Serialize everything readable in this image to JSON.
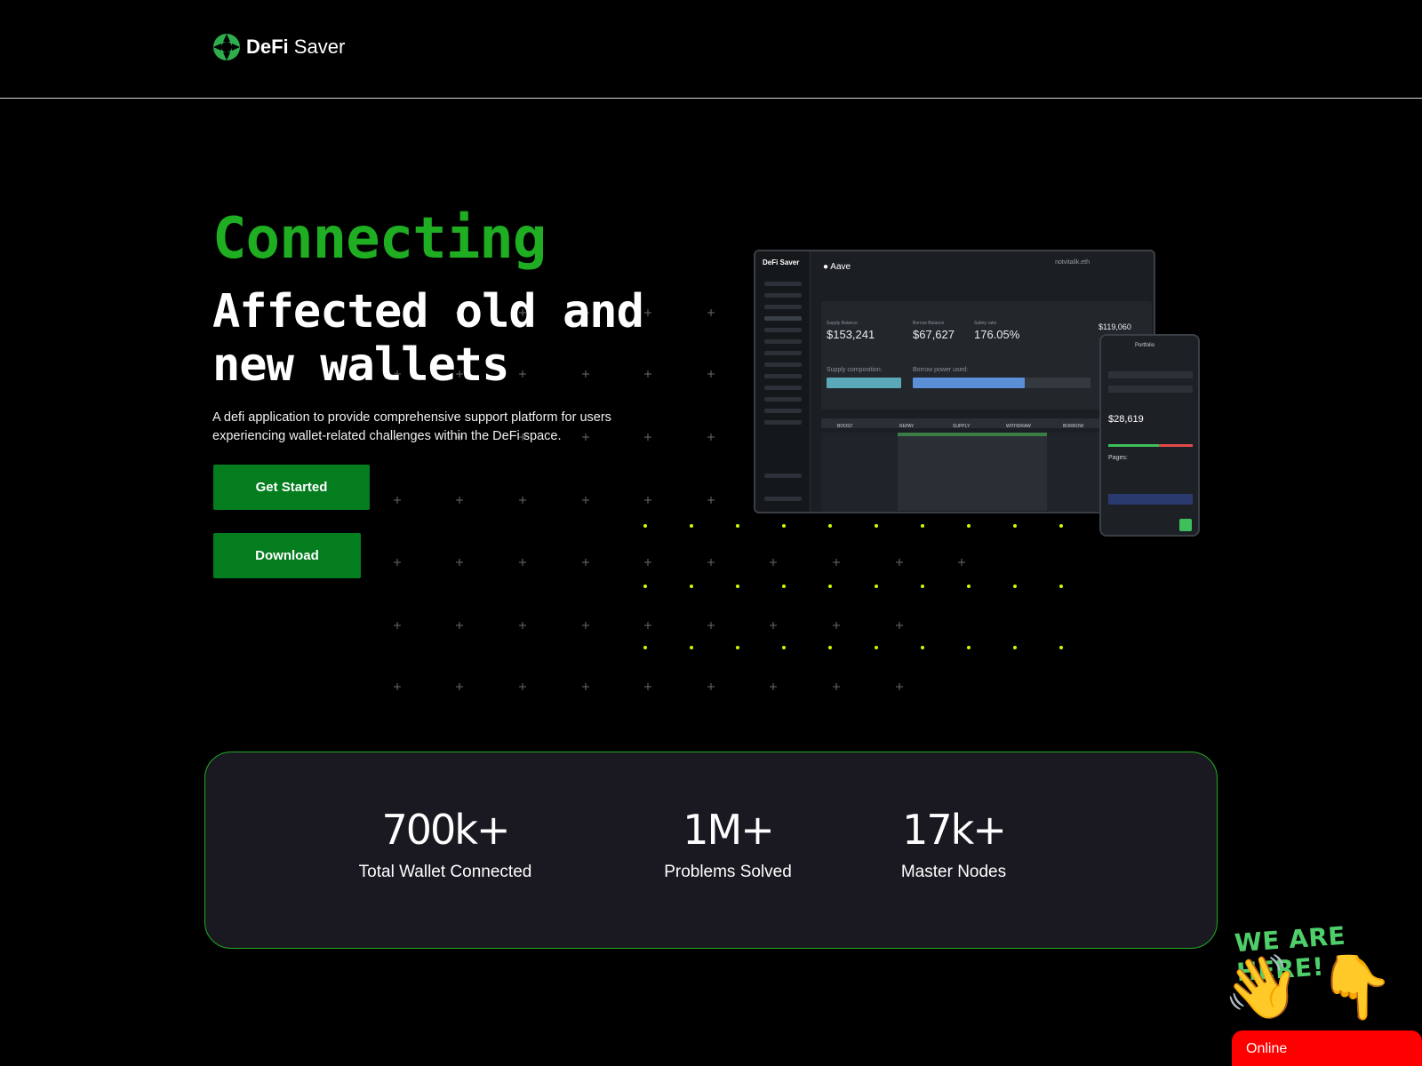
{
  "header": {
    "logo_bold": "DeFi",
    "logo_light": " Saver"
  },
  "hero": {
    "pretitle": "Connecting",
    "title": "Affected old and new wallets",
    "description": "A defi application to provide comprehensive support platform for users experiencing wallet-related challenges within the DeFi space."
  },
  "buttons": {
    "get_started": "Get Started",
    "download": "Download"
  },
  "mockup": {
    "brand": "DeFi Saver",
    "protocol": "Aave",
    "account": "notvitalik.eth",
    "supply_label": "Supply Balance",
    "supply_value": "$153,241",
    "borrow_label": "Borrow Balance",
    "borrow_value": "$67,627",
    "ratio_label": "Safety ratio",
    "ratio_value": "176.05%",
    "limit_value": "$119,060",
    "composition_label": "Supply composition:",
    "borrow_power_label": "Borrow power used:",
    "tabs": [
      "BOOST",
      "REPAY",
      "SUPPLY",
      "WITHDRAW",
      "BORROW"
    ],
    "mobile_title": "Portfolio",
    "mobile_value": "$28,619",
    "mobile_pages": "Pages:"
  },
  "stats": [
    {
      "value": "700k+",
      "label": "Total Wallet Connected"
    },
    {
      "value": "1M+",
      "label": "Problems Solved"
    },
    {
      "value": "17k+",
      "label": "Master Nodes"
    }
  ],
  "widget": {
    "headline": "WE ARE HERE!",
    "status": "Online"
  },
  "colors": {
    "accent": "#1fae22",
    "button": "#047d1f",
    "dot": "#c8ff00",
    "online": "#ff0000"
  }
}
